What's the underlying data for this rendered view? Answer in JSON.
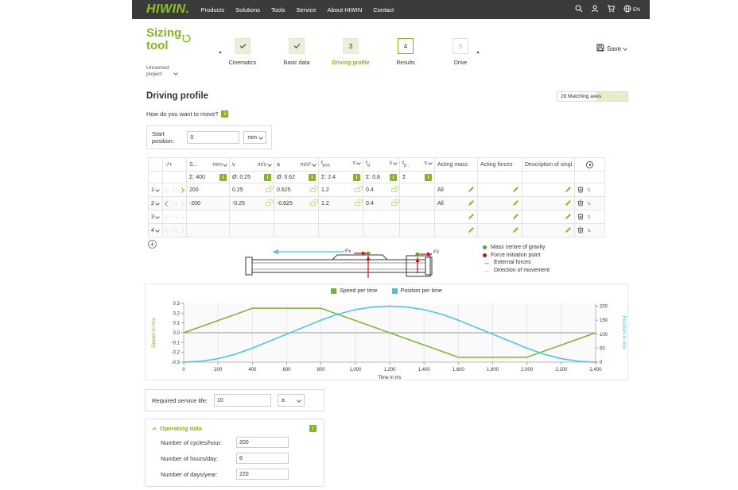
{
  "nav": {
    "logo": "HIWIN.",
    "items": [
      "Products",
      "Solutions",
      "Tools",
      "Service",
      "About HIWIN",
      "Contact"
    ],
    "lang": "EN"
  },
  "header": {
    "title_line1": "Sizing",
    "title_line2": "tool",
    "project_line1": "Unnamed",
    "project_line2": "project",
    "save_label": "Save"
  },
  "stepper": {
    "steps": [
      {
        "label": "Cinematics",
        "num": "",
        "state": "done"
      },
      {
        "label": "Basic data",
        "num": "",
        "state": "done"
      },
      {
        "label": "Driving profile",
        "num": "3",
        "state": "active"
      },
      {
        "label": "Results",
        "num": "4",
        "state": "upcoming"
      },
      {
        "label": "Drive",
        "num": "5",
        "state": "disabled"
      }
    ]
  },
  "page": {
    "heading": "Driving profile",
    "matching_axes": "28 Matching axes",
    "question": "How do you want to move?"
  },
  "start_position": {
    "label": "Start position:",
    "value": "0",
    "unit": "mm"
  },
  "table": {
    "col_minus_plus": "-/+",
    "cols": [
      {
        "label": "S...",
        "sub": "",
        "unit": "mm"
      },
      {
        "label": "v",
        "sub": "",
        "unit": "m/s"
      },
      {
        "label": "a",
        "sub": "",
        "unit": "m/s²"
      },
      {
        "label": "t",
        "sub": "pos",
        "unit": "s"
      },
      {
        "label": "t",
        "sub": "a",
        "unit": "s"
      },
      {
        "label": "t",
        "sub": "p...",
        "unit": "s"
      }
    ],
    "col_mass": "Acting mass",
    "col_forces": "Acting forces",
    "col_desc": "Description of singl...",
    "summary": {
      "s": "Σ: 400",
      "v": "Ø: 0.25",
      "a": "Ø: 0.62",
      "tpos": "Σ: 2.4",
      "ta": "Σ: 0.8",
      "tp": "Σ"
    },
    "rows": [
      {
        "num": "1",
        "s": "200",
        "v": "0.25",
        "a": "0.625",
        "tpos": "1.2",
        "ta": "0.4",
        "tp": "",
        "mass": "All"
      },
      {
        "num": "2",
        "s": "-200",
        "v": "-0.25",
        "a": "-0.625",
        "tpos": "1.2",
        "ta": "0.4",
        "tp": "",
        "mass": "All"
      },
      {
        "num": "3",
        "s": "",
        "v": "",
        "a": "",
        "tpos": "",
        "ta": "",
        "tp": "",
        "mass": ""
      },
      {
        "num": "4",
        "s": "",
        "v": "",
        "a": "",
        "tpos": "",
        "ta": "",
        "tp": "",
        "mass": ""
      }
    ]
  },
  "diagram": {
    "fx_label": "Fx",
    "fz_label": "Fz",
    "legend": [
      {
        "label": "Mass centre of gravity",
        "color": "#4ea72a",
        "type": "dot"
      },
      {
        "label": "Force initiation point",
        "color": "#e30613",
        "type": "dot"
      },
      {
        "label": "External forces",
        "color": "#e30613",
        "type": "arrow"
      },
      {
        "label": "Direction of movement",
        "color": "#3fc6f0",
        "type": "arrow"
      }
    ]
  },
  "chart_data": {
    "type": "line",
    "x_label": "Time in ms",
    "y_left_label": "Speed in m/s",
    "y_right_label": "Position in mm",
    "x_range": [
      0,
      2400
    ],
    "x_tick_step": 200,
    "x_tick_labels": [
      "0",
      "200",
      "400",
      "600",
      "800",
      "1,000",
      "1,200",
      "1,400",
      "1,600",
      "1,800",
      "2,000",
      "2,200",
      "2,400"
    ],
    "y_left_range": [
      -0.3,
      0.3
    ],
    "y_left_ticks": [
      0.3,
      0.2,
      0.1,
      0.0,
      -0.1,
      -0.2,
      -0.3
    ],
    "y_right_range": [
      0,
      210
    ],
    "y_right_ticks": [
      200,
      150,
      100,
      50,
      0
    ],
    "grid": true,
    "legend_position": "top",
    "series": [
      {
        "name": "Speed per time",
        "color": "#76b82a",
        "axis": "left",
        "points": [
          [
            0,
            0
          ],
          [
            400,
            0.25
          ],
          [
            800,
            0.25
          ],
          [
            1600,
            -0.25
          ],
          [
            2000,
            -0.25
          ],
          [
            2400,
            0
          ]
        ]
      },
      {
        "name": "Position per time",
        "color": "#3fc6f0",
        "axis": "right",
        "points": [
          [
            0,
            0
          ],
          [
            100,
            3.1
          ],
          [
            200,
            12.5
          ],
          [
            300,
            28.1
          ],
          [
            400,
            50
          ],
          [
            500,
            75
          ],
          [
            600,
            100
          ],
          [
            700,
            125
          ],
          [
            800,
            150
          ],
          [
            900,
            171.9
          ],
          [
            1000,
            187.5
          ],
          [
            1100,
            196.9
          ],
          [
            1200,
            200
          ],
          [
            1300,
            196.9
          ],
          [
            1400,
            187.5
          ],
          [
            1500,
            171.9
          ],
          [
            1600,
            150
          ],
          [
            1700,
            125
          ],
          [
            1800,
            100
          ],
          [
            1900,
            75
          ],
          [
            2000,
            50
          ],
          [
            2100,
            28.1
          ],
          [
            2200,
            12.5
          ],
          [
            2300,
            3.1
          ],
          [
            2400,
            0
          ]
        ]
      }
    ]
  },
  "service_life": {
    "label": "Required service life:",
    "value": "10",
    "unit": "a"
  },
  "operating": {
    "title": "Operating data",
    "fields": [
      {
        "label": "Number of cycles/hour:",
        "value": "200"
      },
      {
        "label": "Number of hours/day:",
        "value": "8"
      },
      {
        "label": "Number of days/year:",
        "value": "220"
      }
    ]
  },
  "colors": {
    "accent": "#84b81e",
    "accent_light": "#e9f0d8",
    "speed": "#76b82a",
    "position": "#3fc6f0",
    "red": "#e30613"
  }
}
